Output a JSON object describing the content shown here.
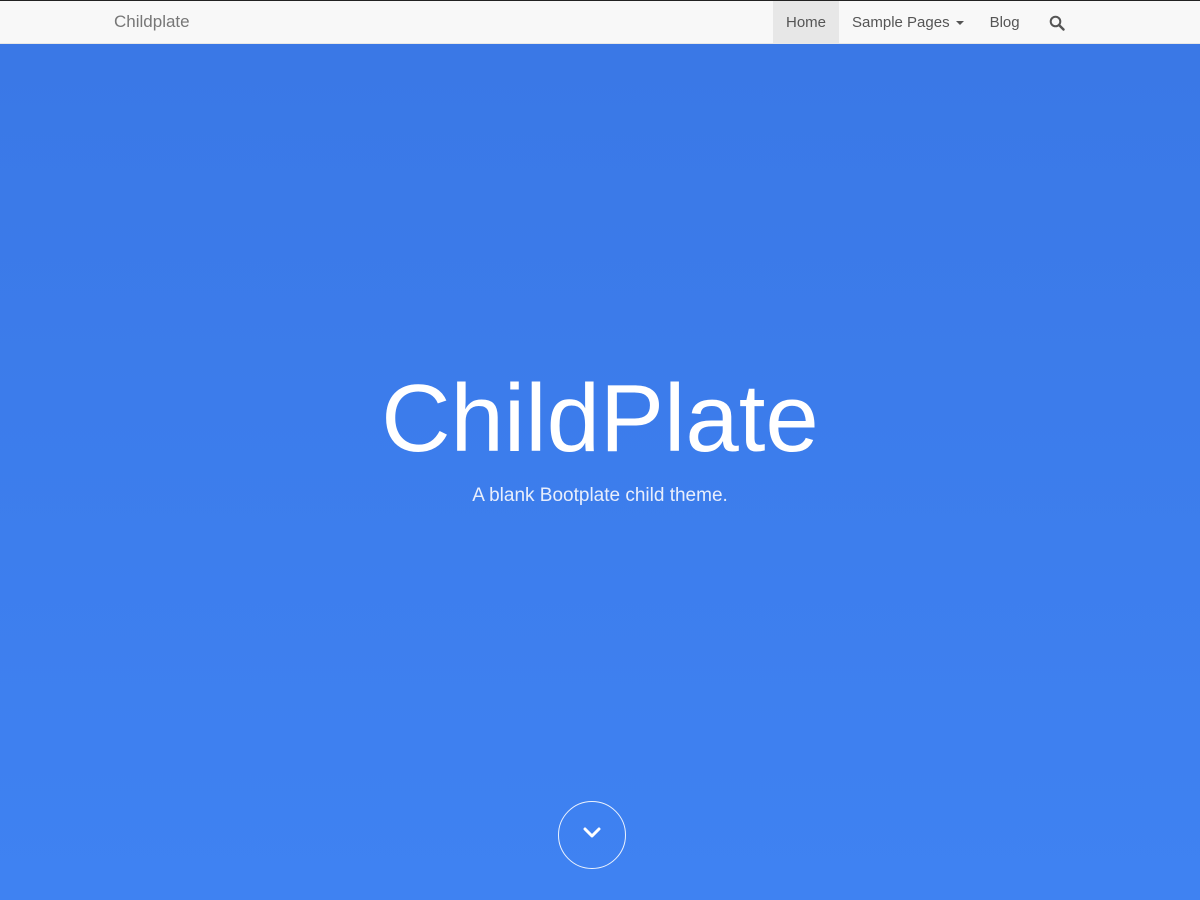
{
  "navbar": {
    "brand": "Childplate",
    "items": [
      {
        "label": "Home"
      },
      {
        "label": "Sample Pages"
      },
      {
        "label": "Blog"
      }
    ],
    "search_icon": "search-icon"
  },
  "hero": {
    "title": "ChildPlate",
    "subtitle": "A blank Bootplate child theme.",
    "scroll_icon": "chevron-down-icon"
  },
  "colors": {
    "hero_background": "#3a7be8",
    "navbar_background": "#f8f8f8",
    "active_item_background": "#e7e7e7"
  }
}
